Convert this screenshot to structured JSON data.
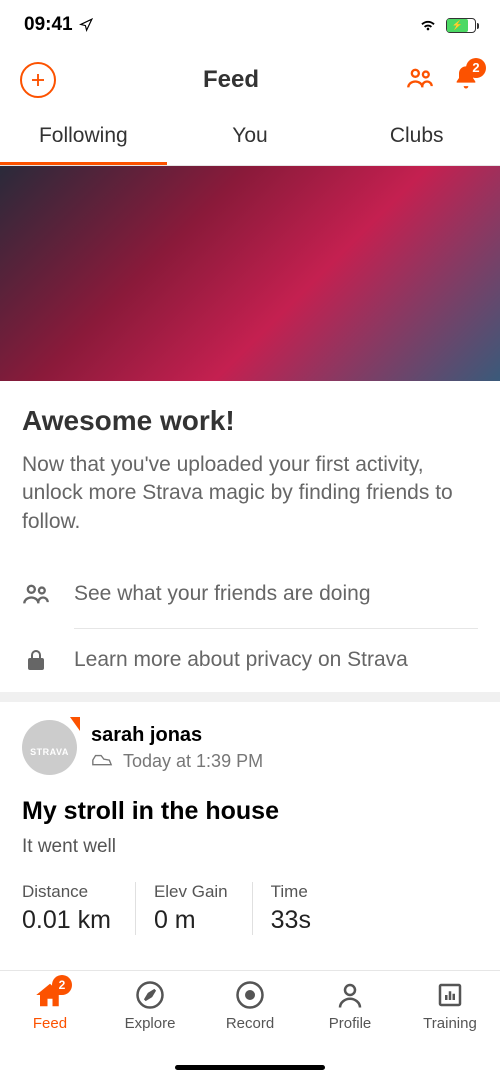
{
  "status": {
    "time": "09:41",
    "location_arrow": "➤"
  },
  "header": {
    "title": "Feed",
    "bell_badge": "2"
  },
  "tabs": {
    "following": "Following",
    "you": "You",
    "clubs": "Clubs"
  },
  "promo": {
    "title": "Awesome work!",
    "text": "Now that you've uploaded your first activity, unlock more Strava magic by finding friends to follow."
  },
  "actions": {
    "friends": "See what your friends are doing",
    "privacy": "Learn more about privacy on Strava"
  },
  "activity": {
    "avatar_label": "STRAVA",
    "user_name": "sarah jonas",
    "timestamp": "Today at 1:39 PM",
    "title": "My stroll in the house",
    "description": "It went well",
    "stats": {
      "distance": {
        "label": "Distance",
        "value": "0.01 km"
      },
      "elev": {
        "label": "Elev Gain",
        "value": "0 m"
      },
      "time": {
        "label": "Time",
        "value": "33s"
      }
    }
  },
  "nav": {
    "feed": {
      "label": "Feed",
      "badge": "2"
    },
    "explore": {
      "label": "Explore"
    },
    "record": {
      "label": "Record"
    },
    "profile": {
      "label": "Profile"
    },
    "training": {
      "label": "Training"
    }
  }
}
